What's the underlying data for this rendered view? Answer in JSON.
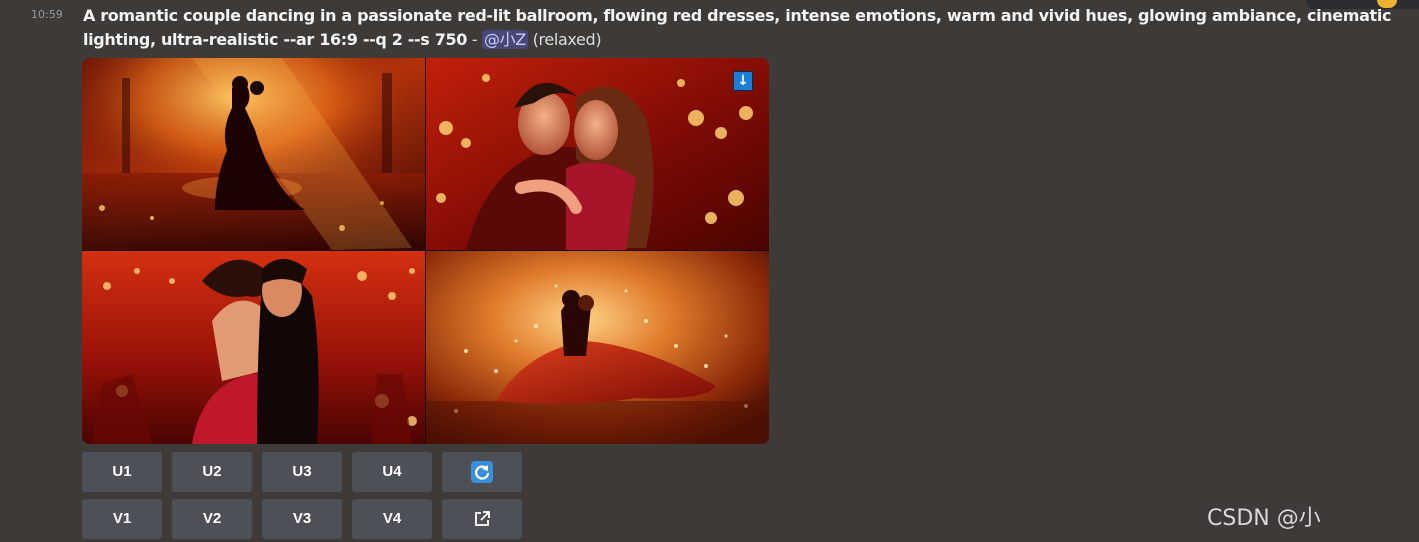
{
  "message": {
    "timestamp": "10:59",
    "prompt_text": "A romantic couple dancing in a passionate red-lit ballroom, flowing red dresses, intense emotions, warm and vivid hues, glowing ambiance, cinematic lighting, ultra-realistic --ar 16:9 --q 2 --s 750",
    "separator": " - ",
    "mention": "@小Z",
    "status": " (relaxed)"
  },
  "image_grid": {
    "download_icon": "↓",
    "tiles": [
      "tile-1",
      "tile-2",
      "tile-3",
      "tile-4"
    ]
  },
  "actions": {
    "upscale": [
      "U1",
      "U2",
      "U3",
      "U4"
    ],
    "variation": [
      "V1",
      "V2",
      "V3",
      "V4"
    ],
    "reroll_icon": "refresh-icon",
    "open_icon": "external-link-icon"
  },
  "watermark": "CSDN @小",
  "colors": {
    "background": "#3d3a37",
    "button": "#4e5058",
    "reroll_blue": "#3b8fd9",
    "mention_bg": "#5865f2"
  }
}
